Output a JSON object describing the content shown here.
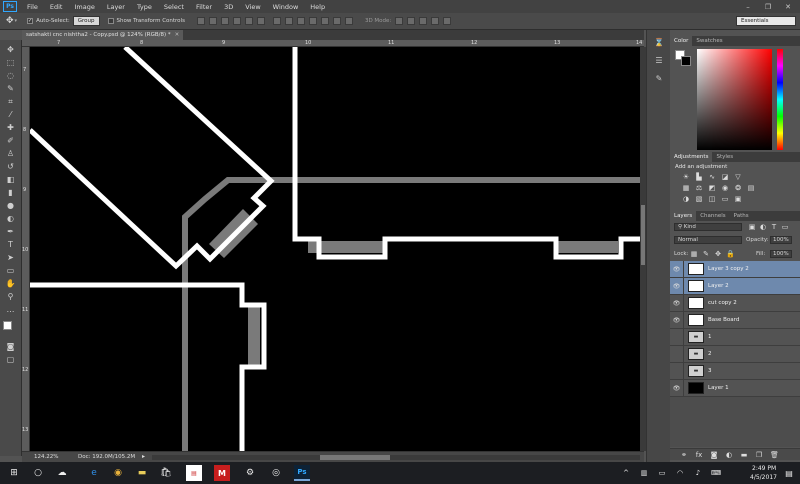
{
  "menubar": {
    "logo": "Ps",
    "items": [
      "File",
      "Edit",
      "Image",
      "Layer",
      "Type",
      "Select",
      "Filter",
      "3D",
      "View",
      "Window",
      "Help"
    ]
  },
  "options": {
    "auto_select_label": "Auto-Select:",
    "auto_select_value": "Group",
    "transform_label": "Show Transform Controls",
    "mode_3d_label": "3D Mode:",
    "workspace": "Essentials"
  },
  "document": {
    "tab_title": "satshakti cnc nishtha2 - Copy.psd @ 124% (RGB/8) *",
    "ruler_top": [
      "7",
      "8",
      "9",
      "10",
      "11",
      "12",
      "13",
      "14"
    ],
    "ruler_left": [
      "7",
      "8",
      "9",
      "10",
      "11",
      "12",
      "13"
    ]
  },
  "status": {
    "zoom": "124.22%",
    "doc_info": "Doc: 192.0M/105.2M"
  },
  "color_panel": {
    "tabs": [
      "Color",
      "Swatches"
    ]
  },
  "adjustments_panel": {
    "tabs": [
      "Adjustments",
      "Styles"
    ],
    "heading": "Add an adjustment"
  },
  "layers_panel": {
    "tabs": [
      "Layers",
      "Channels",
      "Paths"
    ],
    "kind_label": "Kind",
    "blend_mode": "Normal",
    "opacity_label": "Opacity:",
    "opacity_value": "100%",
    "lock_label": "Lock:",
    "fill_label": "Fill:",
    "fill_value": "100%",
    "layers": [
      {
        "name": "Layer 3 copy 2",
        "selected": true,
        "visible": true,
        "thumb": "white"
      },
      {
        "name": "Layer 2",
        "selected": true,
        "visible": true,
        "thumb": "white"
      },
      {
        "name": "cut copy 2",
        "selected": false,
        "visible": true,
        "thumb": "white"
      },
      {
        "name": "Base Board",
        "selected": false,
        "visible": true,
        "thumb": "white"
      },
      {
        "name": "1",
        "selected": false,
        "visible": false,
        "thumb": "folder"
      },
      {
        "name": "2",
        "selected": false,
        "visible": false,
        "thumb": "folder"
      },
      {
        "name": "3",
        "selected": false,
        "visible": false,
        "thumb": "folder"
      },
      {
        "name": "Layer 1",
        "selected": false,
        "visible": true,
        "thumb": "black"
      }
    ]
  },
  "taskbar": {
    "time": "2:49 PM",
    "date": "4/5/2017"
  },
  "colors": {
    "selected_layer": "#6e89ad",
    "canvas_bg": "#000000"
  }
}
